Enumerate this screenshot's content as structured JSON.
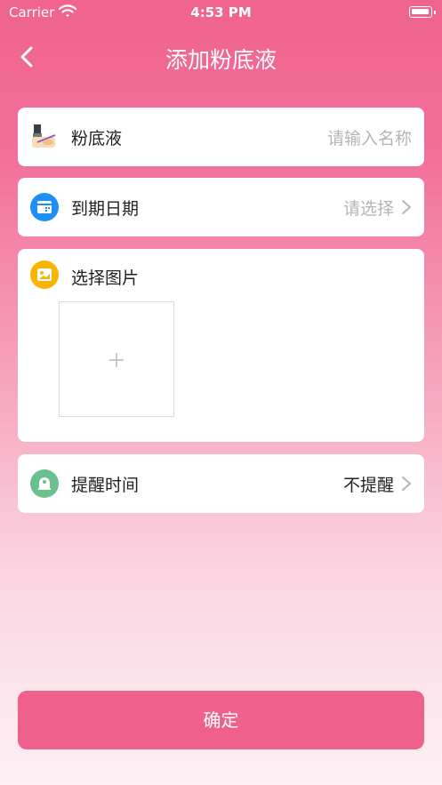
{
  "status_bar": {
    "carrier": "Carrier",
    "time": "4:53 PM"
  },
  "nav": {
    "title": "添加粉底液",
    "back_icon": "chevron-left-icon"
  },
  "form": {
    "name_row": {
      "label": "粉底液",
      "placeholder": "请输入名称",
      "icon": "foundation-icon"
    },
    "expiry_row": {
      "label": "到期日期",
      "value": "请选择",
      "icon": "calendar-icon",
      "icon_color": "#1e90f5"
    },
    "photo_row": {
      "label": "选择图片",
      "icon": "image-icon",
      "icon_color": "#f7b500",
      "add_glyph": "+"
    },
    "reminder_row": {
      "label": "提醒时间",
      "value": "不提醒",
      "icon": "bell-icon",
      "icon_color": "#6cc08e"
    }
  },
  "confirm_button": {
    "label": "确定",
    "color": "#f0608c"
  }
}
